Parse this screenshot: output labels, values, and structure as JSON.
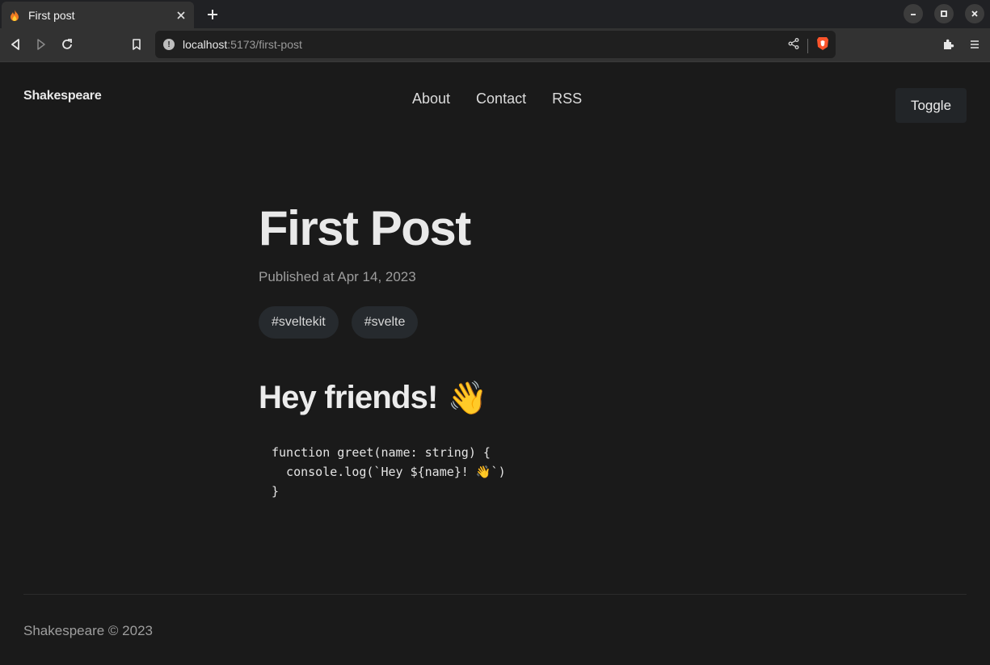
{
  "browser": {
    "tab": {
      "title": "First post",
      "favicon": "flame-icon"
    },
    "address": {
      "host": "localhost",
      "path": ":5173/first-post"
    },
    "colors": {
      "brave_accent": "#fb542b"
    }
  },
  "site": {
    "brand": "Shakespeare",
    "nav": [
      "About",
      "Contact",
      "RSS"
    ],
    "toggle_label": "Toggle"
  },
  "post": {
    "title": "First Post",
    "published": "Published at Apr 14, 2023",
    "tags": [
      "#sveltekit",
      "#svelte"
    ],
    "heading": "Hey friends!",
    "heading_emoji": "👋",
    "code_lines": [
      "function greet(name: string) {",
      "  console.log(`Hey ${name}! 👋`)",
      "}"
    ]
  },
  "footer": {
    "text": "Shakespeare © 2023"
  }
}
